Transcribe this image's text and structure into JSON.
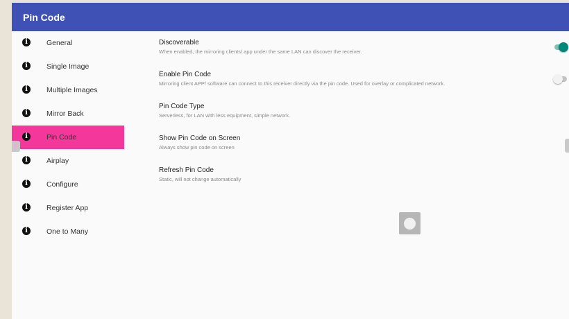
{
  "app_bar": {
    "title": "Pin Code"
  },
  "sidebar": {
    "items": [
      {
        "label": "General",
        "icon": "info-icon"
      },
      {
        "label": "Single Image",
        "icon": "info-icon"
      },
      {
        "label": "Multiple Images",
        "icon": "info-icon"
      },
      {
        "label": "Mirror Back",
        "icon": "info-icon"
      },
      {
        "label": "Pin Code",
        "icon": "info-icon",
        "active": true
      },
      {
        "label": "Airplay",
        "icon": "info-icon"
      },
      {
        "label": "Configure",
        "icon": "info-icon"
      },
      {
        "label": "Register App",
        "icon": "info-icon"
      },
      {
        "label": "One to Many",
        "icon": "info-icon"
      }
    ]
  },
  "settings": [
    {
      "title": "Discoverable",
      "summary": "When enabled, the mirroring clients/ app under the same LAN can discover the receiver.",
      "toggle": true
    },
    {
      "title": "Enable Pin Code",
      "summary": "Mirroring client APP/ software can connect to this receiver directly via the pin code. Used for overlay or complicated network.",
      "toggle": false
    },
    {
      "title": "Pin Code Type",
      "summary": "Serverless, for LAN with less equipment, simple network."
    },
    {
      "title": "Show Pin Code on Screen",
      "summary": "Always show pin code on screen"
    },
    {
      "title": "Refresh Pin Code",
      "summary": "Static, will not change automatically"
    }
  ],
  "colors": {
    "app_bar": "#3f51b5",
    "active_nav": "#f4379a",
    "toggle_on": "#00897b",
    "background": "#fafafa"
  },
  "info_glyph": "i"
}
